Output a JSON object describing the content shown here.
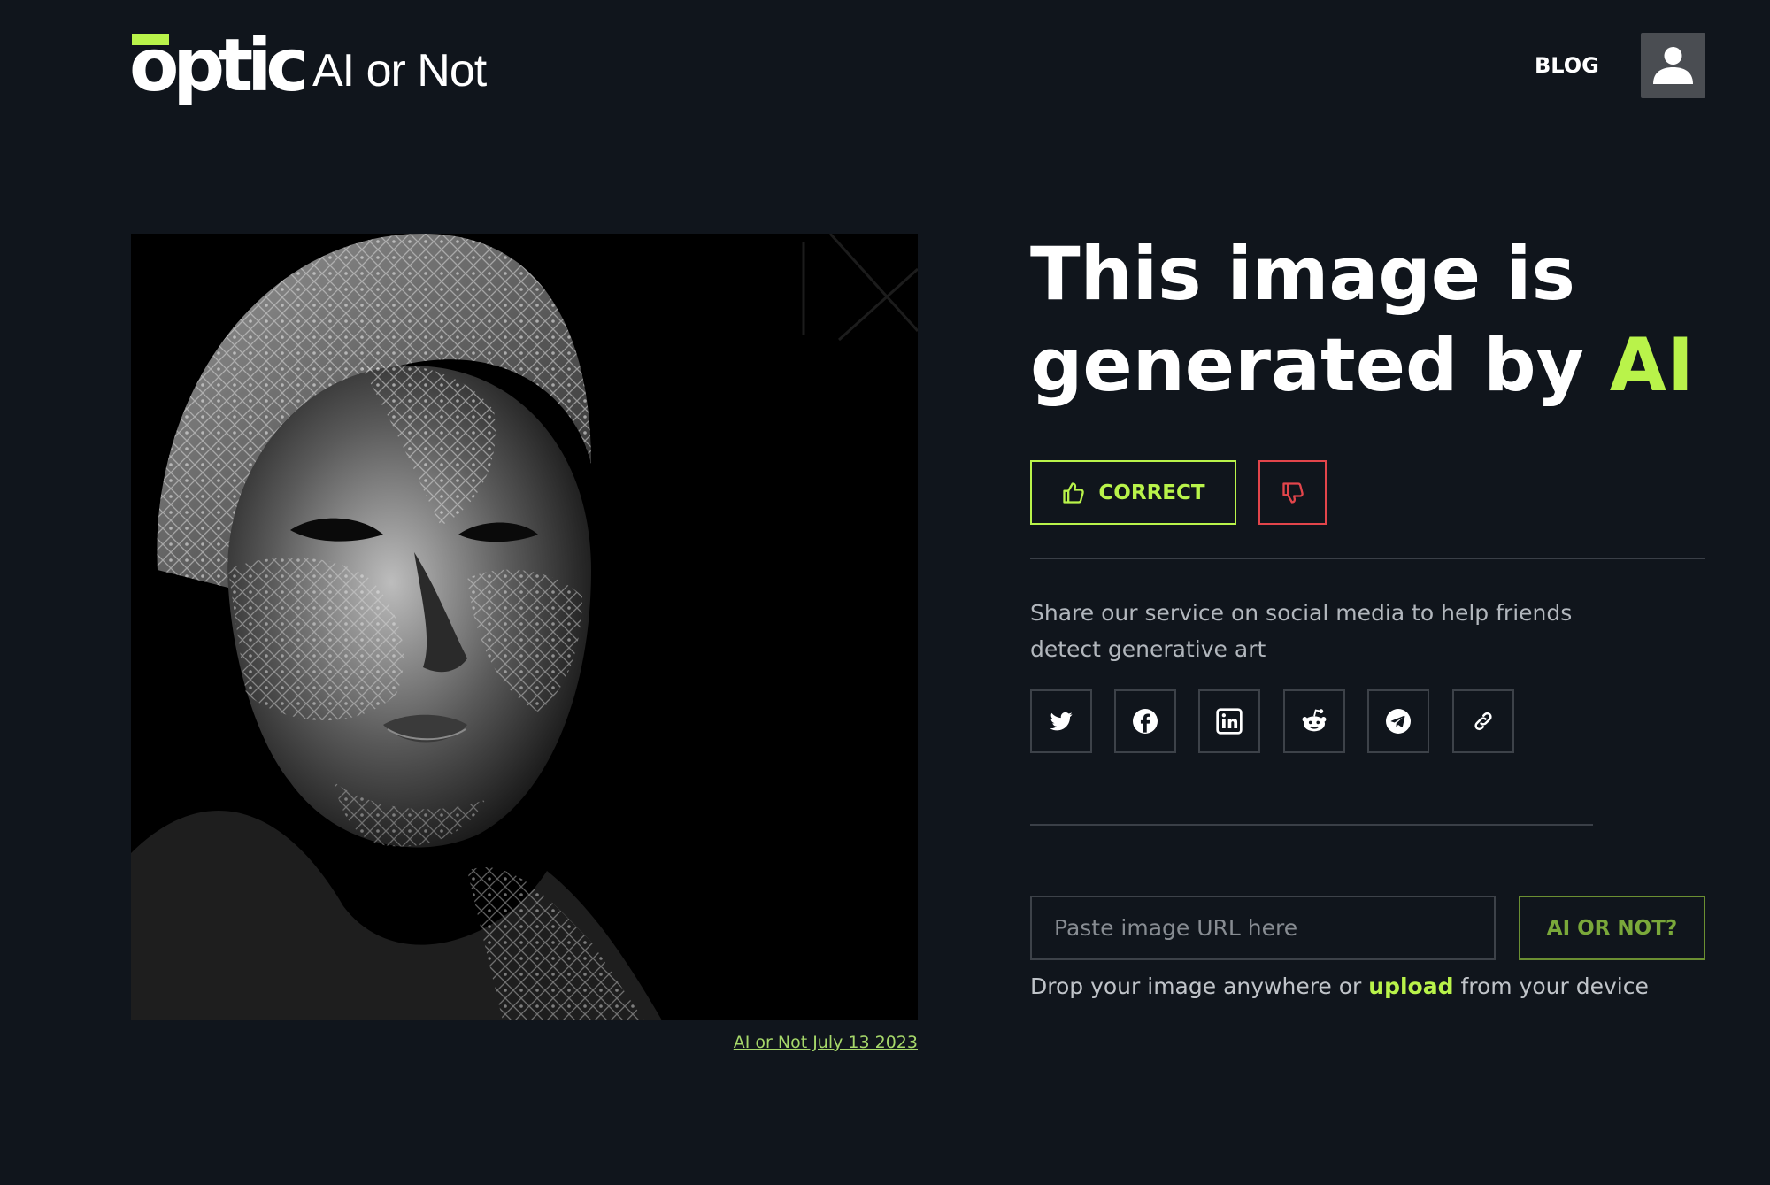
{
  "header": {
    "logo_text": "optic",
    "app_name": "AI or Not",
    "blog_label": "BLOG"
  },
  "image": {
    "caption_link": "AI or Not July 13 2023"
  },
  "result": {
    "headline_prefix": "This image is generated by",
    "headline_accent": "AI",
    "correct_label": "CORRECT"
  },
  "share": {
    "text": "Share our service on social media to help friends detect generative art",
    "buttons": [
      "twitter-icon",
      "facebook-icon",
      "linkedin-icon",
      "reddit-icon",
      "telegram-icon",
      "link-icon"
    ]
  },
  "check": {
    "url_placeholder": "Paste image URL here",
    "submit_label": "AI OR NOT?",
    "drop_prefix": "Drop your image anywhere or",
    "upload_label": "upload",
    "drop_suffix": "from your device"
  },
  "colors": {
    "background": "#10151c",
    "accent": "#b9f34a",
    "danger": "#e2454b"
  }
}
